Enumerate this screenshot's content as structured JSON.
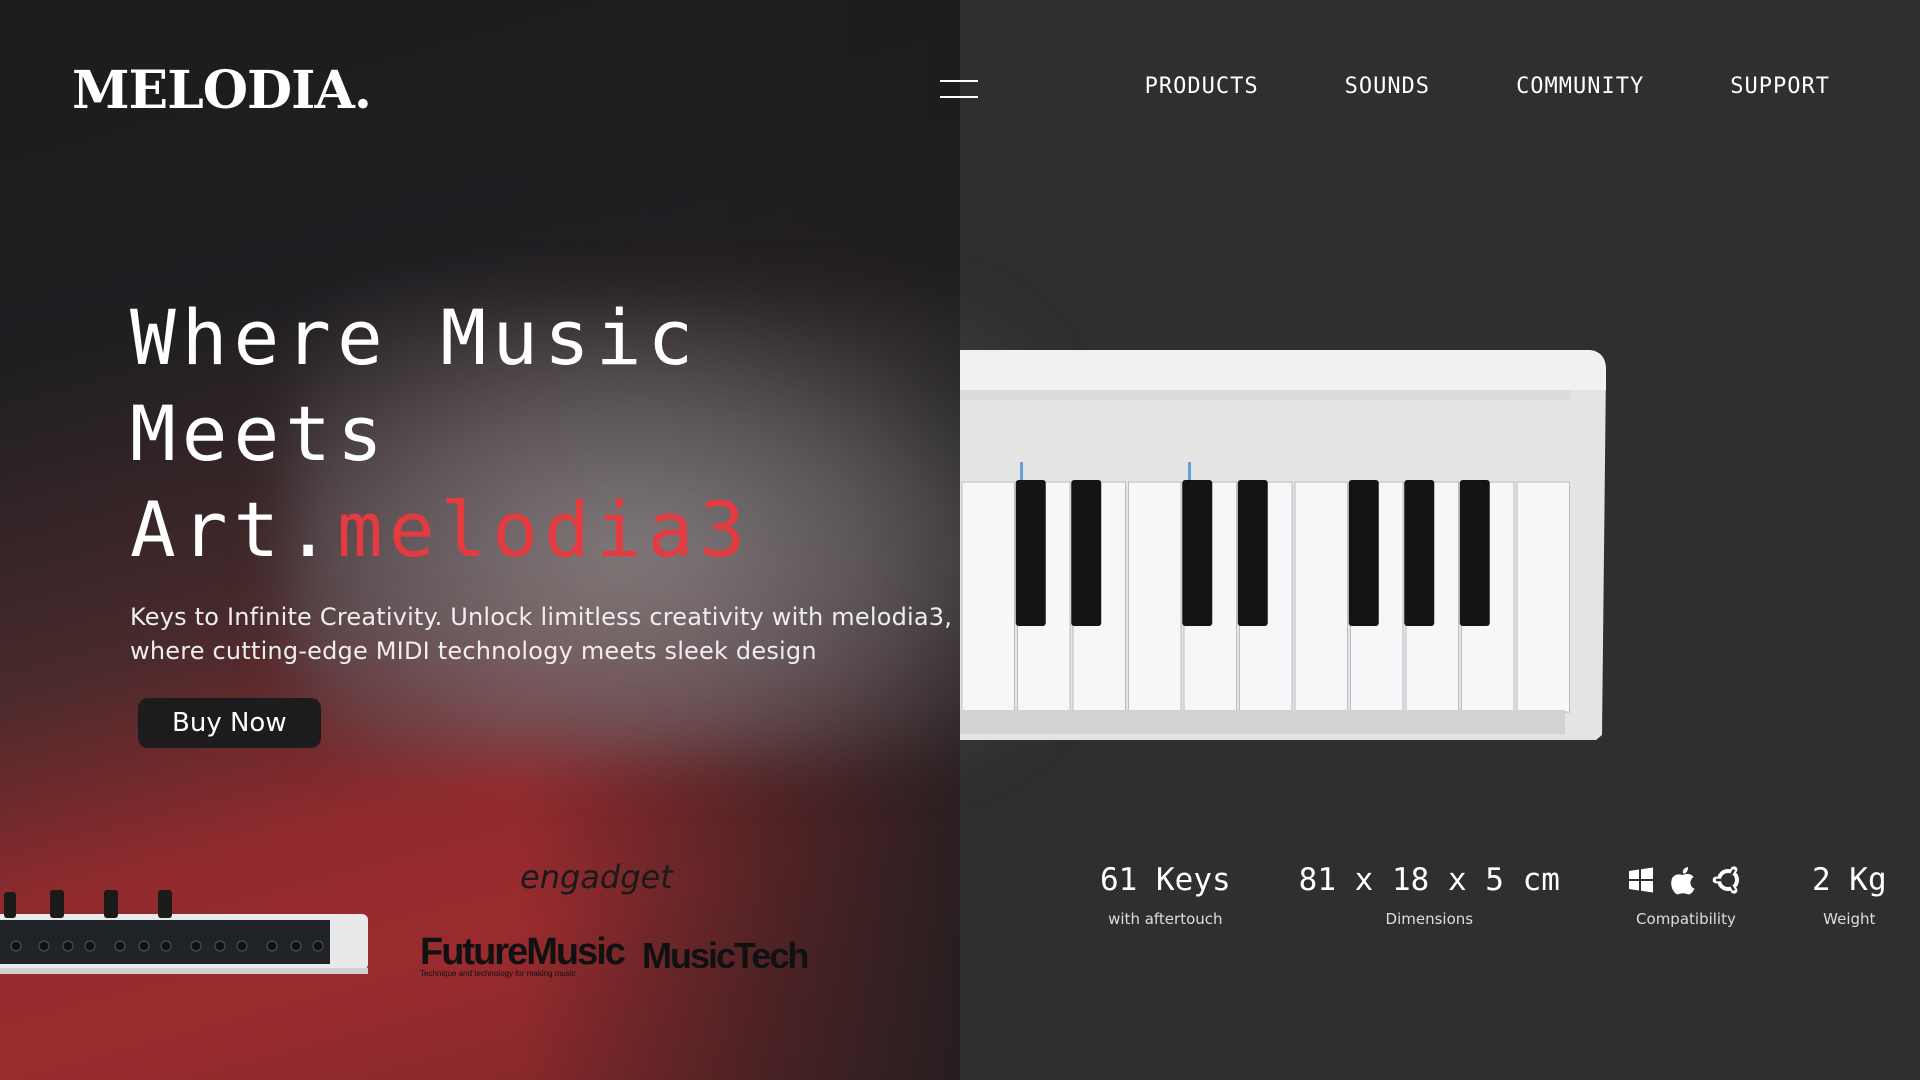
{
  "brand": {
    "logo": "MELODIA."
  },
  "nav": {
    "items": [
      "PRODUCTS",
      "SOUNDS",
      "COMMUNITY",
      "SUPPORT"
    ]
  },
  "hero": {
    "title_line1": "Where Music",
    "title_line2": "Meets Art.",
    "title_accent": "melodia3",
    "subtitle": "Keys to Infinite Creativity. Unlock limitless creativity with melodia3, where cutting-edge MIDI technology meets sleek design",
    "cta": "Buy Now"
  },
  "press": {
    "engadget": "engadget",
    "futuremusic": "FutureMusic",
    "futuremusic_tagline": "Technique and technology for making music",
    "musictech": "MusicTech"
  },
  "specs": [
    {
      "value": "61 Keys",
      "label": "with aftertouch"
    },
    {
      "value": "81 x 18 x 5 cm",
      "label": "Dimensions"
    },
    {
      "value": "",
      "label": "Compatibility",
      "icons": [
        "windows-icon",
        "apple-icon",
        "ubuntu-icon"
      ]
    },
    {
      "value": "2 Kg",
      "label": "Weight"
    }
  ],
  "colors": {
    "accent": "#e53a3f",
    "dark": "#1c1c1e",
    "panel": "#2f2f2f",
    "red": "#9a2b2e"
  }
}
